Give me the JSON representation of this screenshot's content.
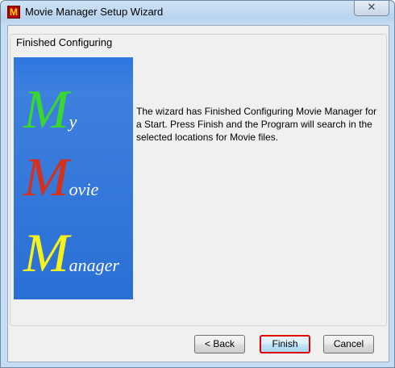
{
  "window": {
    "title": "Movie Manager Setup Wizard",
    "close_glyph": "✕",
    "app_icon_letter": "M"
  },
  "group": {
    "label": "Finished Configuring"
  },
  "banner": {
    "lines": [
      {
        "big": "M",
        "small": "y",
        "color": "#39d831"
      },
      {
        "big": "M",
        "small": "ovie",
        "color": "#d5301c"
      },
      {
        "big": "M",
        "small": "anager",
        "color": "#f4f11c"
      }
    ]
  },
  "description": "The wizard has Finished Configuring Movie Manager for a Start. Press Finish and the Program will search in the selected locations for Movie files.",
  "buttons": {
    "back": "< Back",
    "finish": "Finish",
    "cancel": "Cancel"
  }
}
